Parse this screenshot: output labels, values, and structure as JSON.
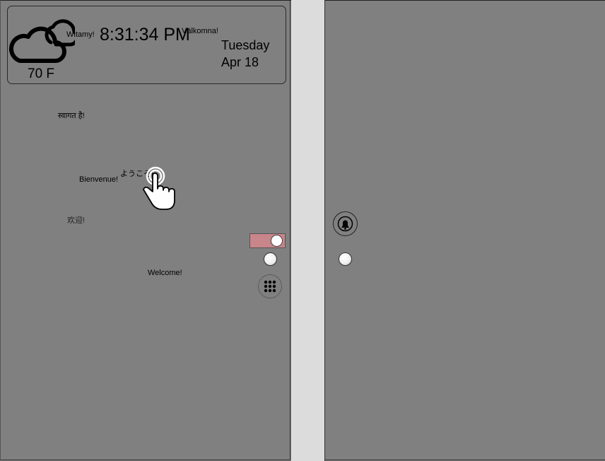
{
  "status_widget": {
    "temperature": "70 F",
    "time": "8:31:34 PM",
    "day": "Tuesday",
    "date": "Apr 18",
    "weather_icon": "cloudy-icon"
  },
  "greetings": {
    "polish": "Witamy!",
    "swedish": "Välkomna!",
    "hindi": "स्वागत है!",
    "japanese": "ようこそ!",
    "french": "Bienvenue!",
    "chinese": "欢迎!",
    "english": "Welcome!"
  },
  "controls": {
    "toggle_state": "on",
    "toggle_color": "#c8858a",
    "apps_icon": "grid-dots-icon",
    "bell_icon": "bell-icon",
    "tap_icon": "tap-hand-icon"
  }
}
